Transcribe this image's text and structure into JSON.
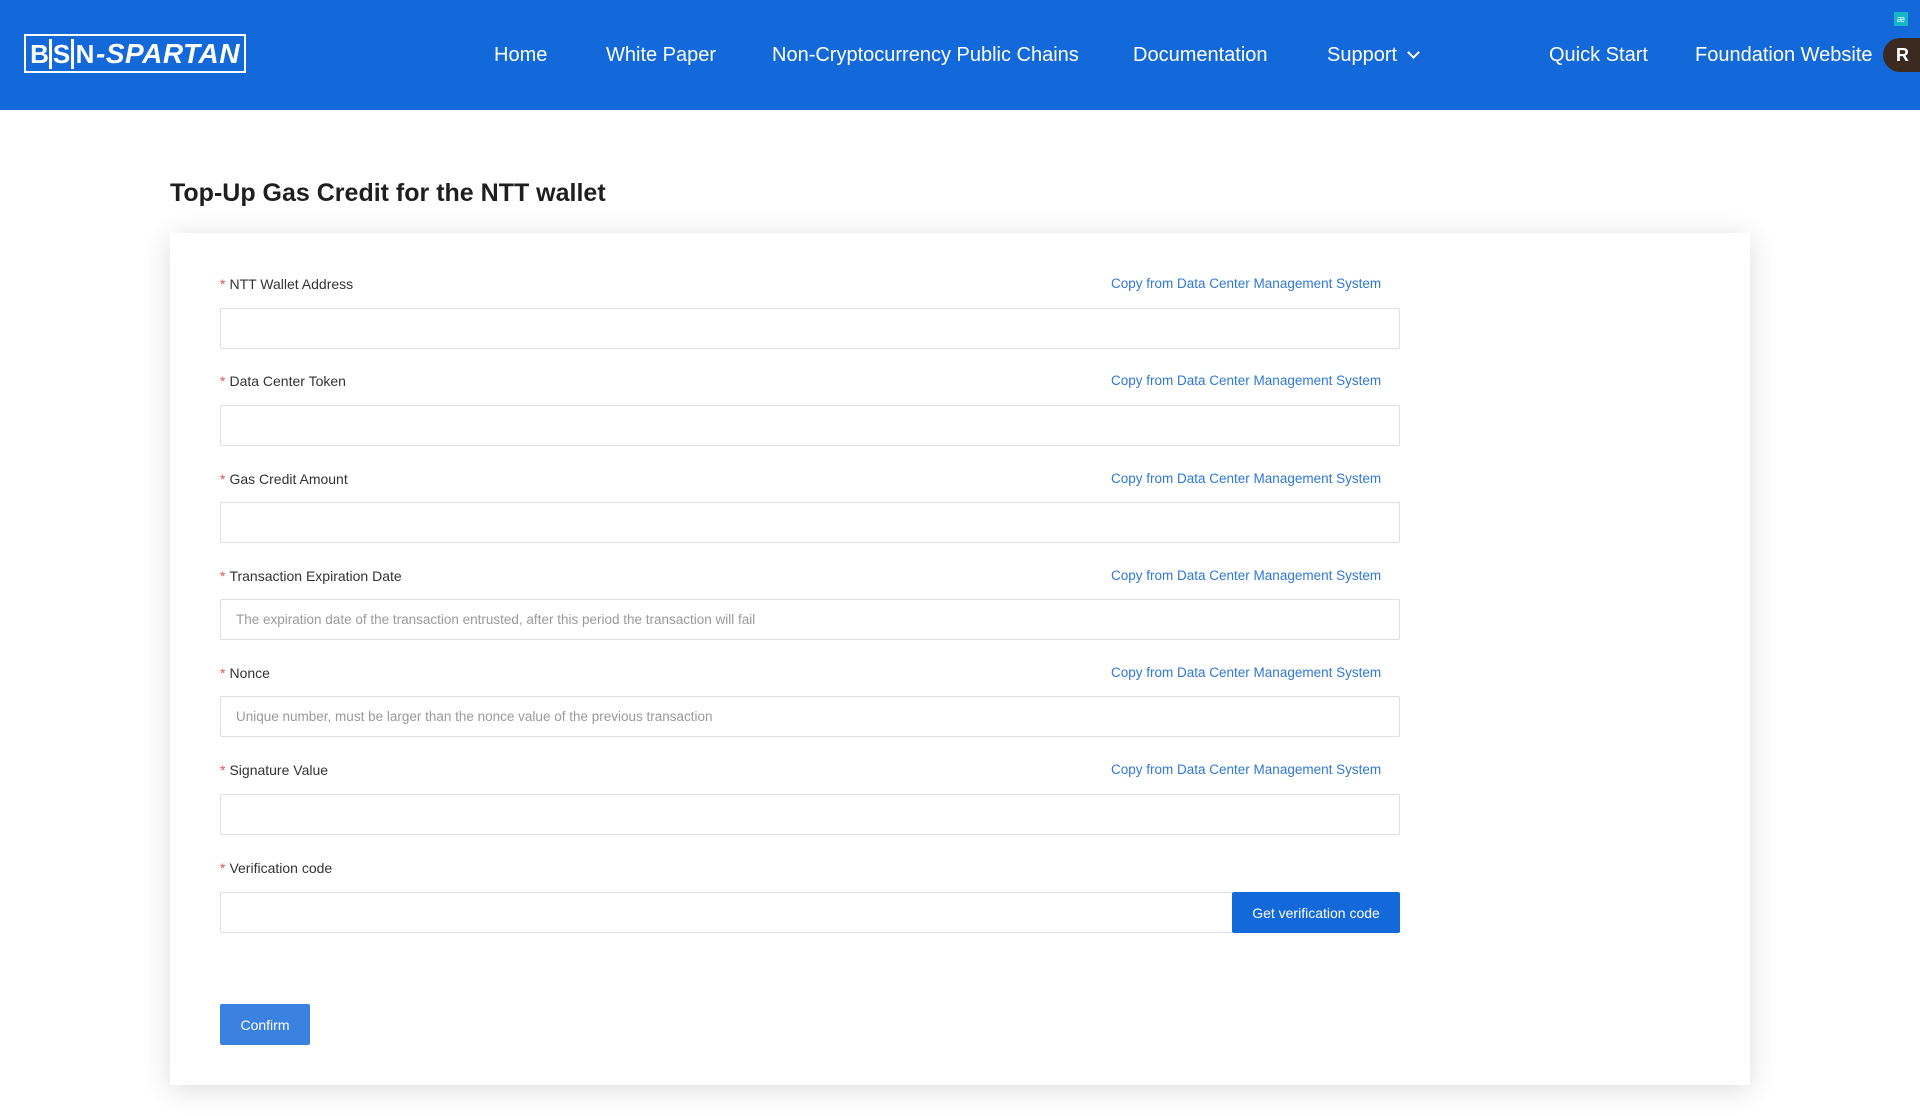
{
  "header": {
    "logo_letters": [
      "B",
      "S",
      "N"
    ],
    "logo_suffix": "-SPARTAN",
    "nav": {
      "home": "Home",
      "white_paper": "White Paper",
      "public_chains": "Non-Cryptocurrency Public Chains",
      "documentation": "Documentation",
      "support": "Support",
      "quick_start": "Quick Start",
      "foundation": "Foundation Website"
    },
    "avatar_initial": "R",
    "extension_badge": "æ"
  },
  "page_title": "Top-Up Gas Credit for the NTT wallet",
  "form": {
    "required_mark": "*",
    "copy_link_text": "Copy from Data Center Management System",
    "fields": [
      {
        "label": "NTT Wallet Address",
        "value": "",
        "placeholder": ""
      },
      {
        "label": "Data Center Token",
        "value": "",
        "placeholder": ""
      },
      {
        "label": "Gas Credit Amount",
        "value": "",
        "placeholder": ""
      },
      {
        "label": "Transaction Expiration Date",
        "value": "",
        "placeholder": "The expiration date of the transaction entrusted, after this period the transaction will fail"
      },
      {
        "label": "Nonce",
        "value": "",
        "placeholder": "Unique number, must be larger than the nonce value of the previous transaction"
      },
      {
        "label": "Signature Value",
        "value": "",
        "placeholder": ""
      }
    ],
    "verification": {
      "label": "Verification code",
      "value": "",
      "placeholder": "",
      "button": "Get verification code"
    },
    "confirm_button": "Confirm"
  },
  "colors": {
    "primary": "#1369d9",
    "link": "#2f78d4",
    "required": "#f04e4e"
  }
}
